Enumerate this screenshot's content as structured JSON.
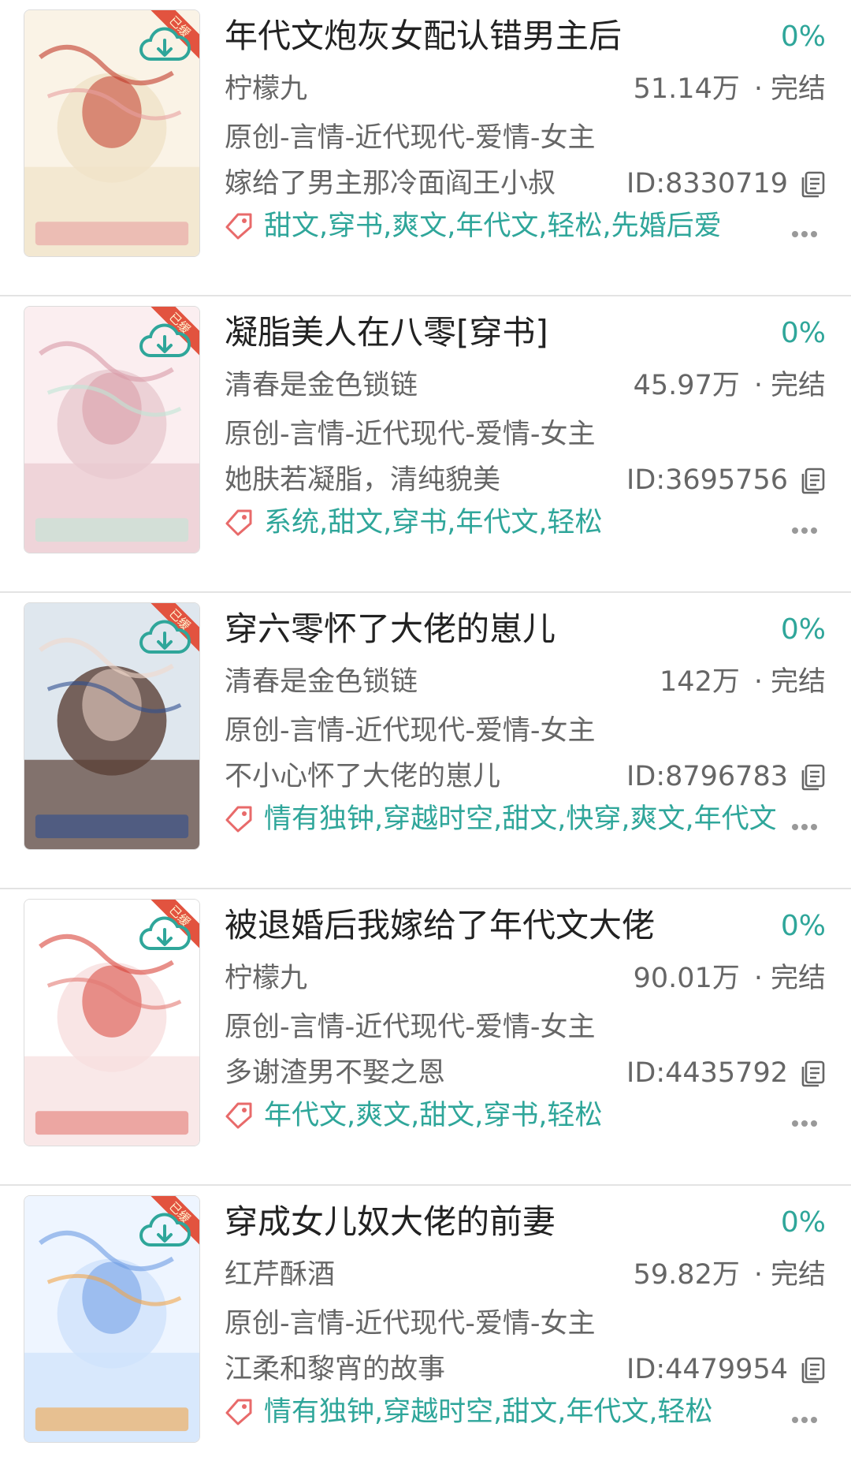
{
  "colors": {
    "accent": "#2fa69a",
    "tag_icon": "#e86a6a",
    "title_text": "#222222",
    "secondary_text": "#666666",
    "divider": "#e3e3e3"
  },
  "books": [
    {
      "title": "年代文炮灰女配认错男主后",
      "progress": "0%",
      "author": "柠檬九",
      "word_count": "51.14万",
      "status": "完结",
      "category": "原创-言情-近代现代-爱情-女主",
      "summary": "嫁给了男主那冷面阎王小叔",
      "id": "ID:8330719",
      "tags": "甜文,穿书,爽文,年代文,轻松,先婚后爱",
      "cover_badge": "已缓",
      "cover_style": "cream-red"
    },
    {
      "title": "凝脂美人在八零[穿书]",
      "progress": "0%",
      "author": "清春是金色锁链",
      "word_count": "45.97万",
      "status": "完结",
      "category": "原创-言情-近代现代-爱情-女主",
      "summary": "她肤若凝脂，清纯貌美",
      "id": "ID:3695756",
      "tags": "系统,甜文,穿书,年代文,轻松",
      "cover_badge": "已缓",
      "cover_style": "pink-girl"
    },
    {
      "title": "穿六零怀了大佬的崽儿",
      "progress": "0%",
      "author": "清春是金色锁链",
      "word_count": "142万",
      "status": "完结",
      "category": "原创-言情-近代现代-爱情-女主",
      "summary": "不小心怀了大佬的崽儿",
      "id": "ID:8796783",
      "tags": "情有独钟,穿越时空,甜文,快穿,爽文,年代文",
      "cover_badge": "已缓",
      "cover_style": "dark-girl"
    },
    {
      "title": "被退婚后我嫁给了年代文大佬",
      "progress": "0%",
      "author": "柠檬九",
      "word_count": "90.01万",
      "status": "完结",
      "category": "原创-言情-近代现代-爱情-女主",
      "summary": "多谢渣男不娶之恩",
      "id": "ID:4435792",
      "tags": "年代文,爽文,甜文,穿书,轻松",
      "cover_badge": "已缓",
      "cover_style": "white-red"
    },
    {
      "title": "穿成女儿奴大佬的前妻",
      "progress": "0%",
      "author": "红芹酥酒",
      "word_count": "59.82万",
      "status": "完结",
      "category": "原创-言情-近代现代-爱情-女主",
      "summary": "江柔和黎宵的故事",
      "id": "ID:4479954",
      "tags": "情有独钟,穿越时空,甜文,年代文,轻松",
      "cover_badge": "已缓",
      "cover_style": "blue-cat"
    }
  ]
}
